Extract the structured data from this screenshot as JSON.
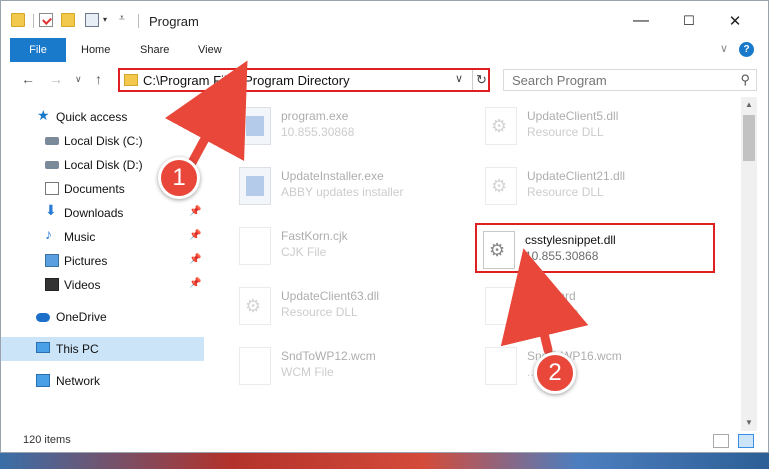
{
  "window": {
    "title": "Program",
    "tabs": [
      {
        "label": "File"
      },
      {
        "label": "Home"
      },
      {
        "label": "Share"
      },
      {
        "label": "View"
      }
    ]
  },
  "navigation": {
    "address_path": "C:\\Program Files\\Program Directory",
    "search_placeholder": "Search Program"
  },
  "sidebar": {
    "items": [
      {
        "label": "Quick access",
        "icon": "star-icon",
        "pinned": false
      },
      {
        "label": "Local Disk (C:)",
        "icon": "disk-icon",
        "pinned": false
      },
      {
        "label": "Local Disk (D:)",
        "icon": "disk-icon",
        "pinned": false
      },
      {
        "label": "Documents",
        "icon": "documents-icon",
        "pinned": false
      },
      {
        "label": "Downloads",
        "icon": "downloads-icon",
        "pinned": true
      },
      {
        "label": "Music",
        "icon": "music-icon",
        "pinned": true
      },
      {
        "label": "Pictures",
        "icon": "pictures-icon",
        "pinned": true
      },
      {
        "label": "Videos",
        "icon": "videos-icon",
        "pinned": true
      },
      {
        "label": "OneDrive",
        "icon": "onedrive-icon",
        "pinned": false
      },
      {
        "label": "This PC",
        "icon": "this-pc-icon",
        "pinned": false,
        "selected": true
      },
      {
        "label": "Network",
        "icon": "network-icon",
        "pinned": false
      }
    ]
  },
  "files": [
    {
      "name": "program.exe",
      "sub": "10.855.30868",
      "icon": "exe-file-icon"
    },
    {
      "name": "UpdateClient5.dll",
      "sub": "Resource DLL",
      "icon": "dll-file-icon"
    },
    {
      "name": "UpdateInstaller.exe",
      "sub": "ABBY updates installer",
      "icon": "exe-file-icon"
    },
    {
      "name": "UpdateClient21.dll",
      "sub": "Resource DLL",
      "icon": "dll-file-icon"
    },
    {
      "name": "FastKorn.cjk",
      "sub": "CJK File",
      "icon": "blank-file-icon"
    },
    {
      "name": "csstylesnippet.dll",
      "sub": "10.855.30868",
      "icon": "dll-file-icon",
      "highlighted": true
    },
    {
      "name": "UpdateClient63.dll",
      "sub": "Resource DLL",
      "icon": "dll-file-icon"
    },
    {
      "name": "...ecward",
      "sub": "...FW File",
      "icon": "blank-file-icon"
    },
    {
      "name": "SndToWP12.wcm",
      "sub": "WCM File",
      "icon": "blank-file-icon"
    },
    {
      "name": "SndToWP16.wcm",
      "sub": "...File",
      "icon": "blank-file-icon"
    }
  ],
  "status": {
    "item_count": "120 items"
  },
  "annotations": [
    {
      "number": "1"
    },
    {
      "number": "2"
    }
  ],
  "colors": {
    "accent": "#1979ca",
    "annotation_red": "#e02020"
  }
}
